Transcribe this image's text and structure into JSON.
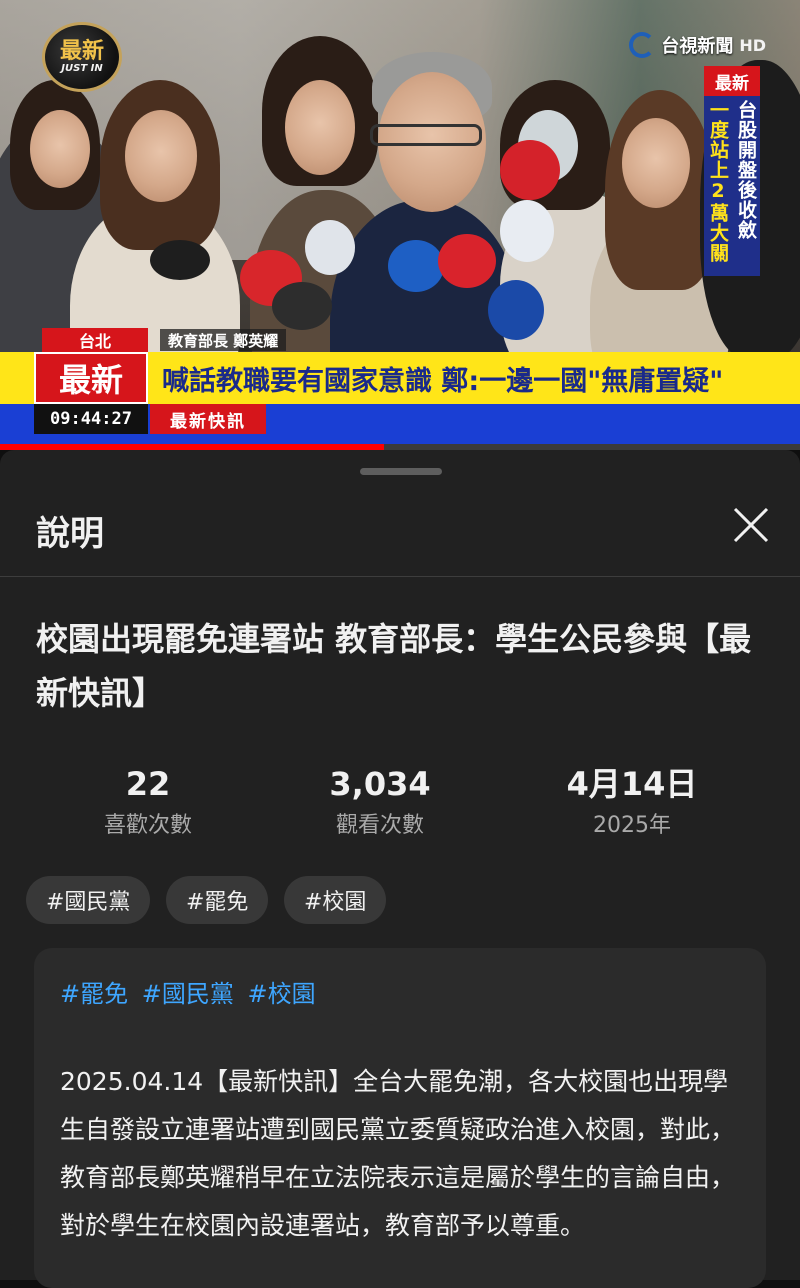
{
  "video": {
    "channel_badge": {
      "big": "最新",
      "small": "JUST IN"
    },
    "channel_logo": {
      "text": "台視新聞",
      "hd": "HD"
    },
    "side_news": {
      "header": "最新",
      "col1": "一度站上2萬大關",
      "col2": "台股開盤後收斂"
    },
    "location": "台北",
    "person_caption": "教育部長 鄭英耀",
    "caption_label": "最新",
    "caption_title": "喊話教職要有國家意識 鄭:一邊一國\"無庸置疑\"",
    "time": "09:44:27",
    "ticker_label": "最新快訊",
    "progress": 0.48
  },
  "sheet": {
    "title": "說明",
    "close_icon": "close-icon",
    "video_title": "校園出現罷免連署站 教育部長：學生公民參與【最新快訊】",
    "stats": [
      {
        "value": "22",
        "label": "喜歡次數"
      },
      {
        "value": "3,034",
        "label": "觀看次數"
      },
      {
        "value": "4月14日",
        "label": "2025年"
      }
    ],
    "chips": [
      "#國民黨",
      "#罷免",
      "#校園"
    ],
    "description": {
      "tags": [
        "#罷免",
        "#國民黨",
        "#校園"
      ],
      "text": "2025.04.14【最新快訊】全台大罷免潮，各大校園也出現學生自發設立連署站遭到國民黨立委質疑政治進入校園，對此，教育部長鄭英耀稍早在立法院表示這是屬於學生的言論自由，對於學生在校園內設連署站，教育部予以尊重。"
    }
  },
  "colors": {
    "background": "#0f0f0f",
    "sheet": "#212121",
    "chip": "#383838",
    "link": "#3ea6ff",
    "news_red": "#d6151b",
    "news_yellow": "#ffe518",
    "news_blue": "#1a3fd4"
  }
}
